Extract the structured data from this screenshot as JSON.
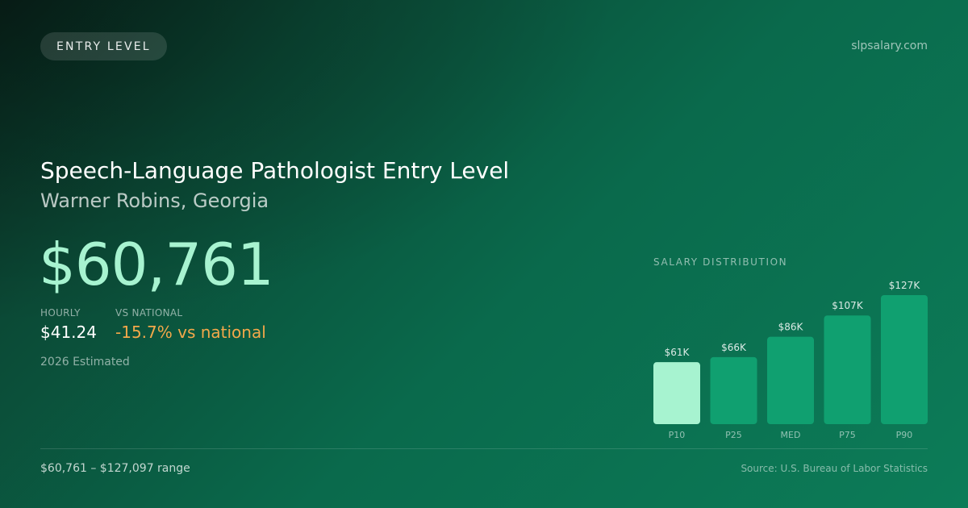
{
  "badge": "ENTRY LEVEL",
  "site": "slpsalary.com",
  "title": "Speech-Language Pathologist Entry Level",
  "subtitle": "Warner Robins, Georgia",
  "salary": "$60,761",
  "hourly": {
    "label": "HOURLY",
    "value": "$41.24"
  },
  "national": {
    "label": "VS NATIONAL",
    "value": "-15.7% vs national"
  },
  "year_note": "2026 Estimated",
  "range": "$60,761 – $127,097 range",
  "source": "Source: U.S. Bureau of Labor Statistics",
  "colors": {
    "accent": "#a7f3d0",
    "bar": "#10a070",
    "negative": "#f3a84a"
  },
  "chart_data": {
    "type": "bar",
    "title": "SALARY DISTRIBUTION",
    "categories": [
      "P10",
      "P25",
      "MED",
      "P75",
      "P90"
    ],
    "values": [
      61,
      66,
      86,
      107,
      127
    ],
    "labels": [
      "$61K",
      "$66K",
      "$86K",
      "$107K",
      "$127K"
    ],
    "unit": "$K",
    "highlight_index": 0,
    "ylim": [
      0,
      127
    ],
    "grid": false
  }
}
